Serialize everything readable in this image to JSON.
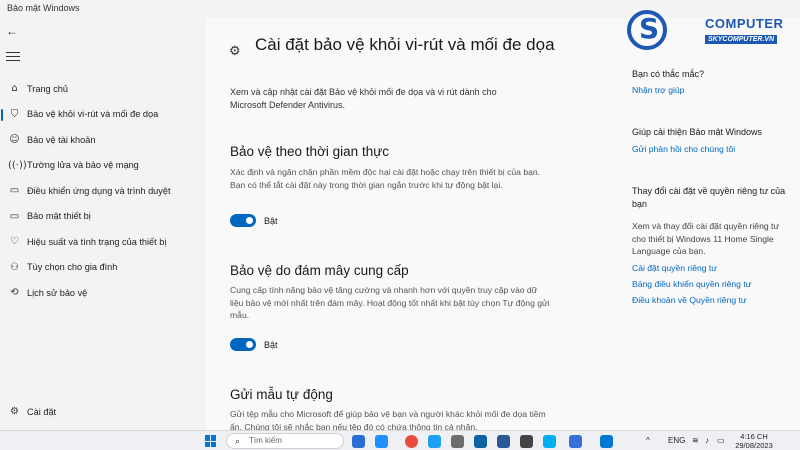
{
  "window": {
    "title": "Bảo mật Windows"
  },
  "sidebar": {
    "items": [
      {
        "label": "Trang chủ",
        "icon": "home-icon"
      },
      {
        "label": "Bảo vệ khỏi vi-rút và mối đe dọa",
        "icon": "shield-icon"
      },
      {
        "label": "Bảo vệ tài khoản",
        "icon": "person-icon"
      },
      {
        "label": "Tường lửa và bảo vệ mạng",
        "icon": "wifi-icon"
      },
      {
        "label": "Điều khiển ứng dụng và trình duyệt",
        "icon": "app-browser-icon"
      },
      {
        "label": "Bảo mật thiết bị",
        "icon": "laptop-icon"
      },
      {
        "label": "Hiệu suất và tình trạng của thiết bị",
        "icon": "heart-icon"
      },
      {
        "label": "Tùy chọn cho gia đình",
        "icon": "family-icon"
      },
      {
        "label": "Lịch sử bảo vệ",
        "icon": "history-icon"
      }
    ],
    "settings_label": "Cài đặt"
  },
  "main": {
    "title": "Cài đặt bảo vệ khỏi vi-rút và mối đe dọa",
    "intro": "Xem và cập nhật cài đặt Bảo vệ khỏi mối đe dọa và vi rút dành cho Microsoft Defender Antivirus.",
    "sections": [
      {
        "title": "Bảo vệ theo thời gian thực",
        "description": "Xác định và ngăn chặn phần mềm độc hại cài đặt hoặc chạy trên thiết bị của bạn. Bạn có thể tắt cài đặt này trong thời gian ngắn trước khi tự động bật lại.",
        "toggle_label": "Bật",
        "toggle_on": true
      },
      {
        "title": "Bảo vệ do đám mây cung cấp",
        "description": "Cung cấp tính năng bảo vệ tăng cường và nhanh hơn với quyền truy cập vào dữ liệu bảo vệ mới nhất trên đám mây. Hoạt động tốt nhất khi bật tùy chọn Tự động gửi mẫu.",
        "toggle_label": "Bật",
        "toggle_on": true
      },
      {
        "title": "Gửi mẫu tự động",
        "description": "Gửi tệp mẫu cho Microsoft để giúp bảo vệ bạn và người khác khỏi mối đe dọa tiềm ẩn. Chúng tôi sẽ nhắc bạn nếu tệp đó có chứa thông tin cá nhân."
      }
    ]
  },
  "right": {
    "q_title": "Bạn có thắc mắc?",
    "q_link": "Nhận trợ giúp",
    "improve_title": "Giúp cải thiện Bảo mật Windows",
    "improve_link": "Gửi phản hồi cho chúng tôi",
    "privacy_title": "Thay đổi cài đặt về quyền riêng tư của bạn",
    "privacy_text": "Xem và thay đổi cài đặt quyền riêng tư cho thiết bị Windows 11 Home Single Language của bạn.",
    "privacy_links": [
      "Cài đặt quyền riêng tư",
      "Bảng điều khiển quyền riêng tư",
      "Điều khoản về Quyền riêng tư"
    ]
  },
  "watermark": {
    "name": "COMPUTER",
    "domain": "SKYCOMPUTER.VN",
    "color": "#1d58b3"
  },
  "taskbar": {
    "search_placeholder": "Tìm kiếm",
    "language": "ENG",
    "time": "4:16 CH",
    "date": "29/08/2023",
    "accent": "#0078d4"
  }
}
